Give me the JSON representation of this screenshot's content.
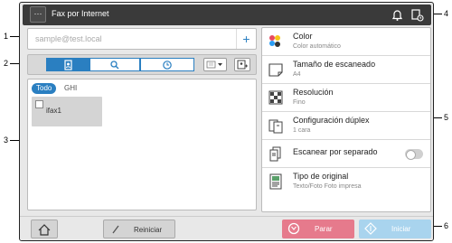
{
  "header": {
    "menu_label": "···",
    "title": "Fax por Internet"
  },
  "address": {
    "placeholder": "sample@test.local",
    "add_label": "+"
  },
  "list": {
    "filters": [
      "Todo",
      "GHI"
    ],
    "entries": [
      {
        "label": "ifax1"
      }
    ]
  },
  "settings": [
    {
      "title": "Color",
      "value": "Color automático",
      "icon": "color-icon"
    },
    {
      "title": "Tamaño de escaneado",
      "value": "A4",
      "icon": "scan-size-icon"
    },
    {
      "title": "Resolución",
      "value": "Fino",
      "icon": "resolution-icon"
    },
    {
      "title": "Configuración dúplex",
      "value": "1 cara",
      "icon": "duplex-icon"
    },
    {
      "title": "Escanear por separado",
      "value": "",
      "icon": "separate-scan-icon"
    },
    {
      "title": "Tipo de original",
      "value": "Texto/Foto Foto impresa",
      "icon": "original-type-icon"
    }
  ],
  "footer": {
    "reset_label": "Reiniciar",
    "stop_label": "Parar",
    "start_label": "Iniciar"
  },
  "callouts": [
    "1",
    "2",
    "3",
    "4",
    "5",
    "6"
  ],
  "colors": {
    "header_bg": "#3a3a3a",
    "accent": "#2a7fc1",
    "stop": "#e67a8c",
    "start": "#a9d4ee"
  }
}
